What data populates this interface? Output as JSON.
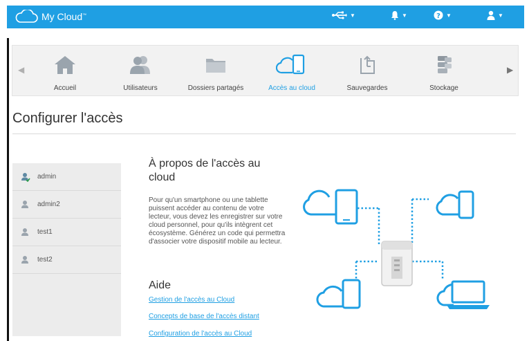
{
  "header": {
    "title": "My Cloud",
    "trademark": "™"
  },
  "nav": {
    "items": [
      {
        "label": "Accueil"
      },
      {
        "label": "Utilisateurs"
      },
      {
        "label": "Dossiers partagés"
      },
      {
        "label": "Accès au cloud",
        "active": true
      },
      {
        "label": "Sauvegardes"
      },
      {
        "label": "Stockage"
      }
    ]
  },
  "page": {
    "title": "Configurer l'accès"
  },
  "users": [
    {
      "name": "admin",
      "icon": "admin-user-icon"
    },
    {
      "name": "admin2",
      "icon": "user-icon"
    },
    {
      "name": "test1",
      "icon": "user-icon"
    },
    {
      "name": "test2",
      "icon": "user-icon"
    }
  ],
  "about": {
    "title": "À propos de l'accès au cloud",
    "text": "Pour qu'un smartphone ou une tablette puissent accéder au contenu de votre lecteur, vous devez les enregistrer sur votre cloud personnel, pour qu'ils intègrent cet écosystème. Générez un code qui permettra d'associer votre dispositif mobile au lecteur."
  },
  "help": {
    "title": "Aide",
    "links": [
      "Gestion de l'accès au Cloud",
      "Concepts de base de l'accès distant",
      "Configuration de l'accès au Cloud"
    ]
  },
  "colors": {
    "accent": "#1f9fe3",
    "topbar": "#1f9fe3"
  }
}
